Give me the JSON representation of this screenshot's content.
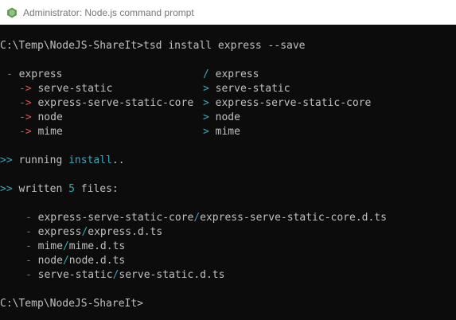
{
  "window": {
    "title": "Administrator: Node.js command prompt",
    "icon": "nodejs-icon"
  },
  "terminal": {
    "prompt1": "C:\\Temp\\NodeJS-ShareIt>",
    "command": "tsd install express --save",
    "tree": {
      "left_root_bullet": "-",
      "left_root": "express",
      "right_root_bullet": "/",
      "right_root": "express",
      "rows": [
        {
          "left_arrow": "->",
          "left": "serve-static",
          "right_arrow": ">",
          "right": "serve-static"
        },
        {
          "left_arrow": "->",
          "left": "express-serve-static-core",
          "right_arrow": ">",
          "right": "express-serve-static-core"
        },
        {
          "left_arrow": "->",
          "left": "node",
          "right_arrow": ">",
          "right": "node"
        },
        {
          "left_arrow": "->",
          "left": "mime",
          "right_arrow": ">",
          "right": "mime"
        }
      ]
    },
    "running_marker": ">>",
    "running_text": "running",
    "running_cmd": "install",
    "running_suffix": "..",
    "written_marker": ">>",
    "written_text": "written",
    "written_count": "5",
    "written_suffix": "files:",
    "files": [
      {
        "dir": "express-serve-static-core",
        "file": "express-serve-static-core.d.ts"
      },
      {
        "dir": "express",
        "file": "express.d.ts"
      },
      {
        "dir": "mime",
        "file": "mime.d.ts"
      },
      {
        "dir": "node",
        "file": "node.d.ts"
      },
      {
        "dir": "serve-static",
        "file": "serve-static.d.ts"
      }
    ],
    "file_bullet": "-",
    "file_sep": "/",
    "prompt2": "C:\\Temp\\NodeJS-ShareIt>"
  }
}
